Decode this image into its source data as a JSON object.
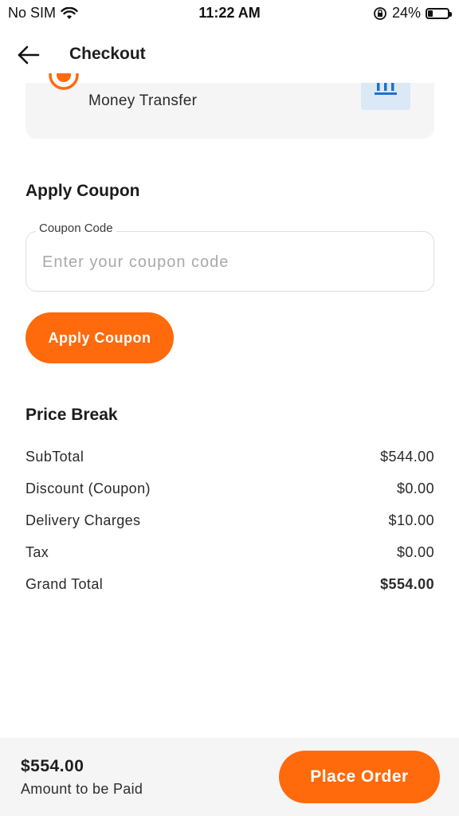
{
  "status_bar": {
    "carrier": "No SIM",
    "time": "11:22 AM",
    "battery_percent": "24%",
    "battery_level": 0.24,
    "icons": [
      "wifi-icon",
      "orientation-lock-icon",
      "battery-icon"
    ]
  },
  "header": {
    "title": "Checkout",
    "back_icon": "arrow-left-icon"
  },
  "payment": {
    "selected_method": "Money Transfer",
    "icons": [
      "radio-selected-icon",
      "bank-icon"
    ]
  },
  "coupon": {
    "section_title": "Apply Coupon",
    "field_label": "Coupon Code",
    "placeholder": "Enter your coupon code",
    "value": "",
    "apply_label": "Apply Coupon"
  },
  "price_break": {
    "title": "Price Break",
    "rows": [
      {
        "label": "SubTotal",
        "value": "$544.00"
      },
      {
        "label": "Discount (Coupon)",
        "value": "$0.00"
      },
      {
        "label": "Delivery Charges",
        "value": "$10.00"
      },
      {
        "label": "Tax",
        "value": "$0.00"
      },
      {
        "label": "Grand Total",
        "value": "$554.00"
      }
    ]
  },
  "footer": {
    "amount": "$554.00",
    "caption": "Amount to be Paid",
    "place_order_label": "Place Order"
  },
  "colors": {
    "accent": "#ff6a0c",
    "card_bg": "#f5f5f5",
    "bank_tile": "#dbe8f6",
    "bank_icon": "#1f6fd1"
  }
}
